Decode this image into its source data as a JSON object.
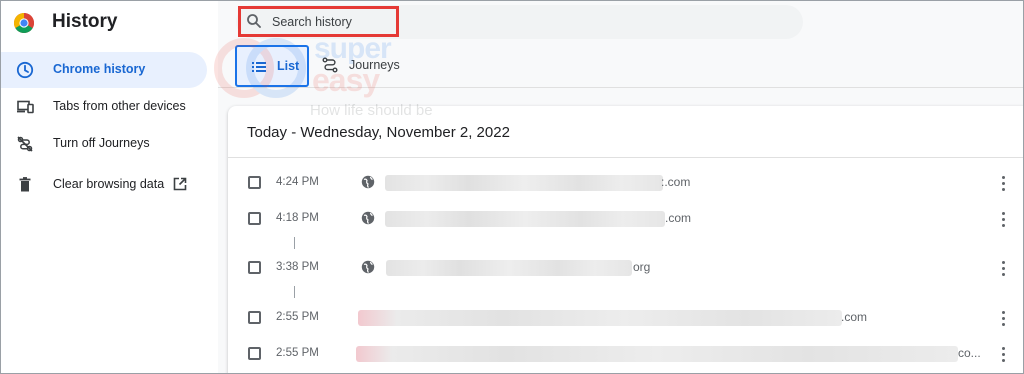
{
  "app": {
    "title": "History"
  },
  "sidebar": {
    "items": [
      {
        "label": "Chrome history",
        "icon": "clock-icon",
        "active": true
      },
      {
        "label": "Tabs from other devices",
        "icon": "devices-icon",
        "active": false
      },
      {
        "label": "Turn off Journeys",
        "icon": "journeys-off-icon",
        "active": false
      },
      {
        "label": "Clear browsing data",
        "icon": "trash-icon",
        "active": false,
        "external": true
      }
    ]
  },
  "search": {
    "placeholder": "Search history",
    "value": ""
  },
  "tabs": [
    {
      "label": "List",
      "icon": "list-icon",
      "selected": true
    },
    {
      "label": "Journeys",
      "icon": "journeys-icon",
      "selected": false
    }
  ],
  "watermark": {
    "line1": "super",
    "line2": "easy",
    "tagline": "How life should be"
  },
  "history": {
    "date_header": "Today - Wednesday, November 2, 2022",
    "entries": [
      {
        "time": "4:24 PM",
        "domain_suffix": ":.com"
      },
      {
        "time": "4:18 PM",
        "domain_suffix": ".com"
      },
      {
        "time": "3:38 PM",
        "domain_suffix": "org"
      },
      {
        "time": "2:55 PM",
        "domain_suffix": ".com"
      },
      {
        "time": "2:55 PM",
        "domain_suffix": "co..."
      }
    ]
  },
  "colors": {
    "accent": "#1a73e8",
    "active_bg": "#e8f0fe",
    "highlight": "#e53935",
    "background": "#f8f9fa"
  }
}
